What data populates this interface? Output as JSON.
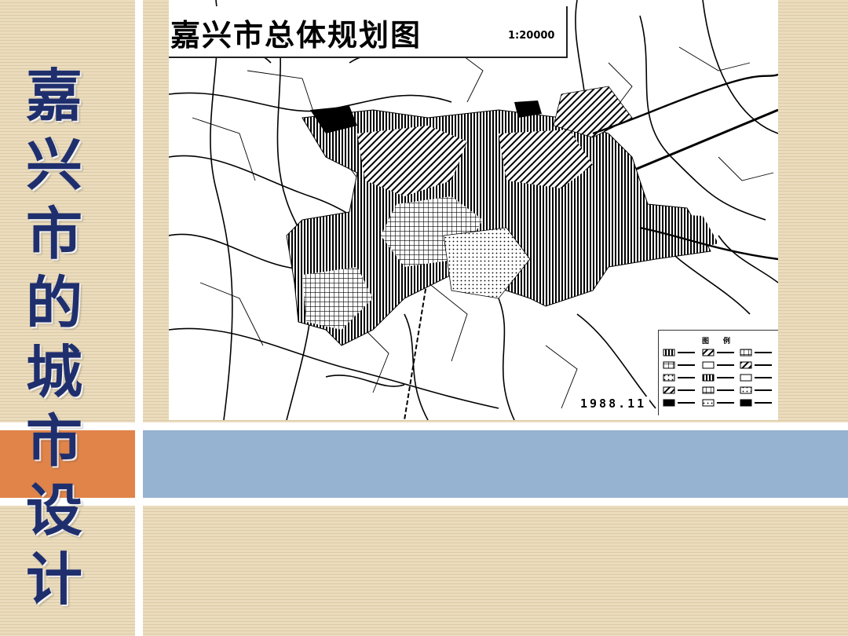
{
  "slide": {
    "vertical_title_chars": [
      "嘉",
      "兴",
      "市",
      "的",
      "城",
      "市",
      "设",
      "计"
    ],
    "colors": {
      "background": "#ebdcbd",
      "title": "#1f2f6e",
      "orange_accent": "#e0844a",
      "blue_accent": "#96b3d1"
    }
  },
  "map": {
    "title": "嘉兴市总体规划图",
    "scale": "1:20000",
    "date": "1988.11",
    "legend_title": "图例"
  }
}
